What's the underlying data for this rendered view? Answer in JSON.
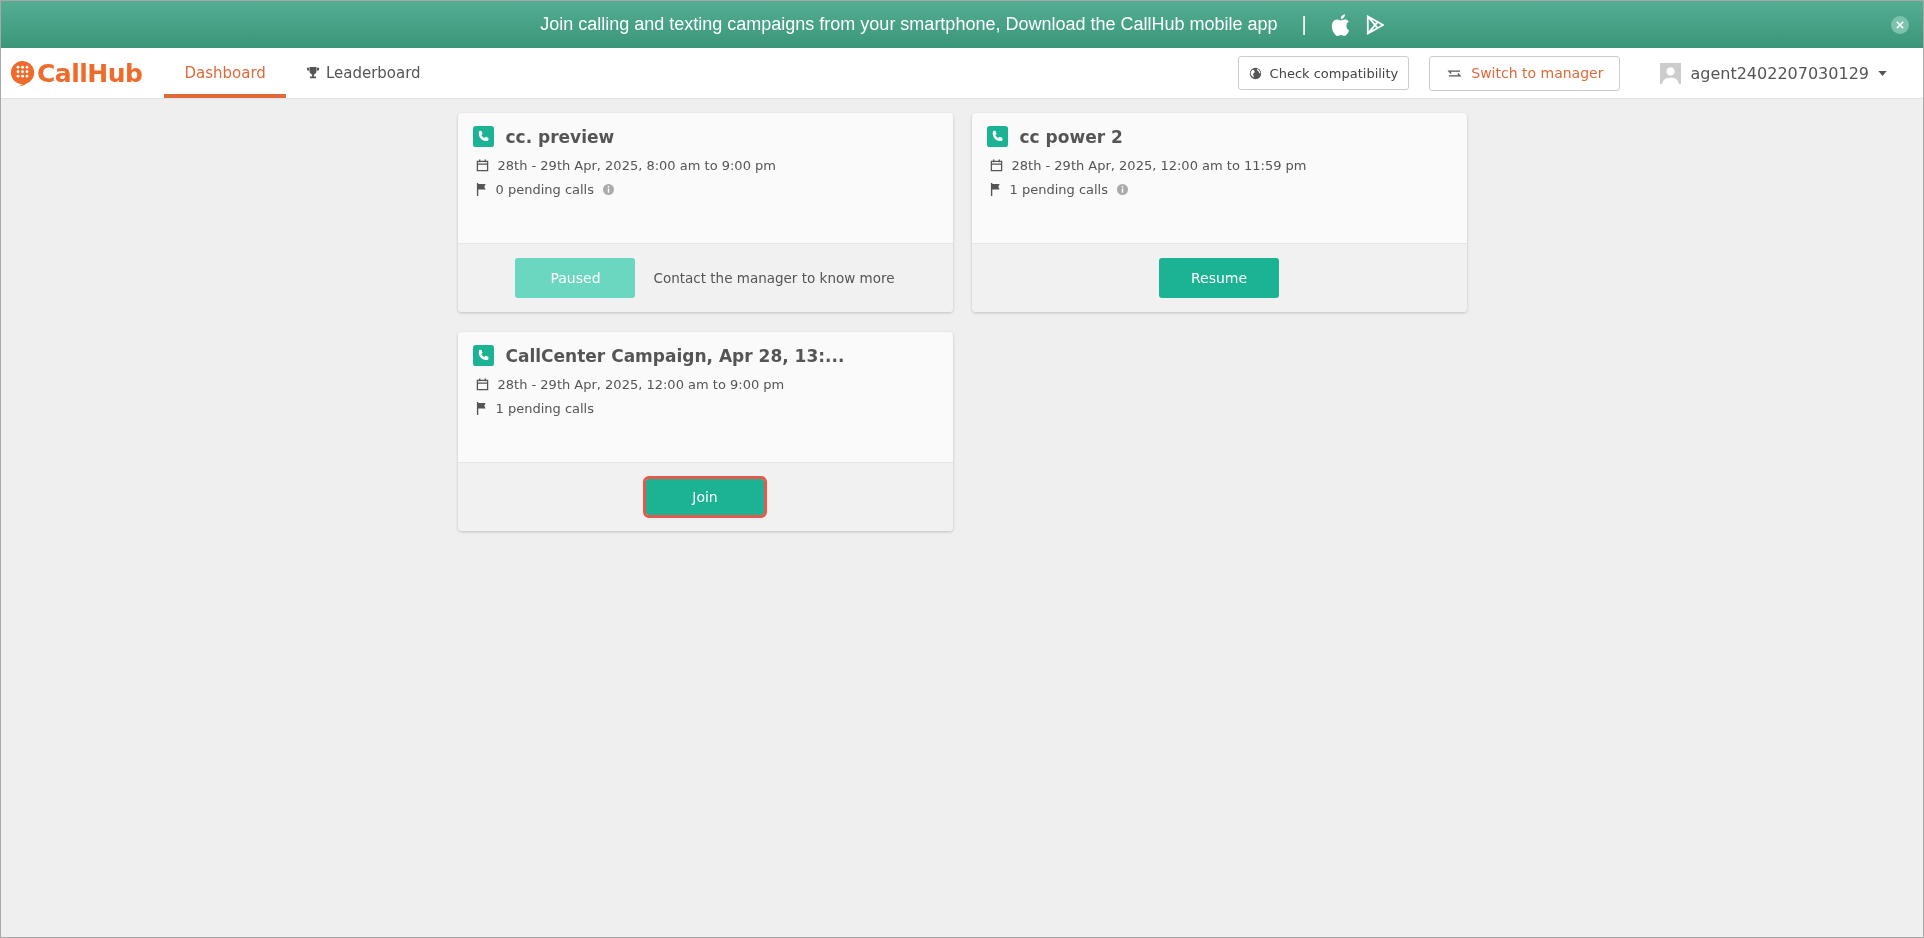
{
  "banner": {
    "text": "Join calling and texting campaigns from your smartphone, Download the CallHub mobile app",
    "separator": "|"
  },
  "nav": {
    "logo": "CallHub",
    "tabs": [
      {
        "label": "Dashboard",
        "selected": true,
        "kind": "plain"
      },
      {
        "label": "Leaderboard",
        "selected": false,
        "kind": "ranking"
      }
    ],
    "check_button": "Check compatibility",
    "switch_button": "Switch to manager",
    "user": "agent2402207030129"
  },
  "campaigns": [
    {
      "title": "cc. preview",
      "schedule": "28th - 29th Apr, 2025,  8:00 am to 9:00 pm",
      "pending": "0 pending calls",
      "info_icon": true,
      "action": {
        "label": "Paused",
        "disabled": true,
        "highlighted": false
      },
      "note": "Contact the manager to know more"
    },
    {
      "title": "cc power 2",
      "schedule": "28th - 29th Apr, 2025,  12:00 am to 11:59 pm",
      "pending": "1 pending calls",
      "info_icon": true,
      "action": {
        "label": "Resume",
        "disabled": false,
        "highlighted": false
      }
    },
    {
      "title": "CallCenter Campaign, Apr 28, 13:...",
      "schedule": "28th - 29th Apr, 2025,  12:00 am to 9:00 pm",
      "pending": "1 pending calls",
      "info_icon": false,
      "action": {
        "label": "Join",
        "disabled": false,
        "highlighted": true
      }
    }
  ]
}
